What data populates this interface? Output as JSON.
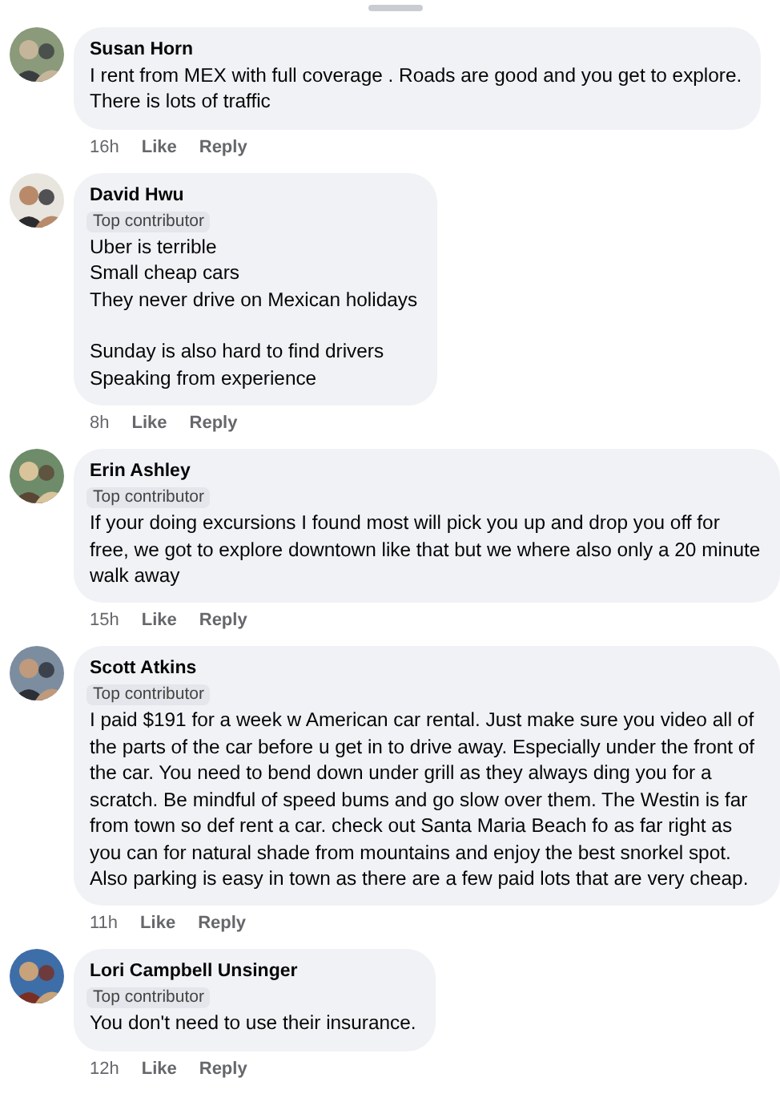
{
  "comments": [
    {
      "author": "Susan Horn",
      "top_contributor": false,
      "text": "I rent from MEX with full coverage .  Roads are good and you get to explore.\nThere is lots of traffic",
      "time": "16h",
      "like": "Like",
      "reply": "Reply"
    },
    {
      "author": "David Hwu",
      "top_contributor": true,
      "badge": "Top contributor",
      "text": "Uber is terrible\nSmall cheap cars\nThey never drive on Mexican holidays\n\nSunday is also hard to find drivers\nSpeaking from experience",
      "time": "8h",
      "like": "Like",
      "reply": "Reply"
    },
    {
      "author": "Erin Ashley",
      "top_contributor": true,
      "badge": "Top contributor",
      "text": "If your doing excursions I found most will pick you up and drop you off for free, we got to explore downtown like that but we where also only a 20 minute walk away",
      "time": "15h",
      "like": "Like",
      "reply": "Reply"
    },
    {
      "author": "Scott Atkins",
      "top_contributor": true,
      "badge": "Top contributor",
      "text": "I paid $191 for a week w American car rental. Just make sure you video all of the parts of the car before u get in to drive away. Especially under the front of the car. You need to bend down under grill as they always ding you for a scratch. Be mindful of speed bums and go slow over them. The Westin is far from town so def rent a car. check out Santa Maria Beach fo as far right as you can for natural shade from mountains and enjoy the best snorkel spot. Also parking is easy in town as there are a few paid lots that are very cheap.",
      "time": "11h",
      "like": "Like",
      "reply": "Reply"
    },
    {
      "author": "Lori Campbell Unsinger",
      "top_contributor": true,
      "badge": "Top contributor",
      "text": "You don't need to use their insurance.",
      "time": "12h",
      "like": "Like",
      "reply": "Reply"
    }
  ]
}
